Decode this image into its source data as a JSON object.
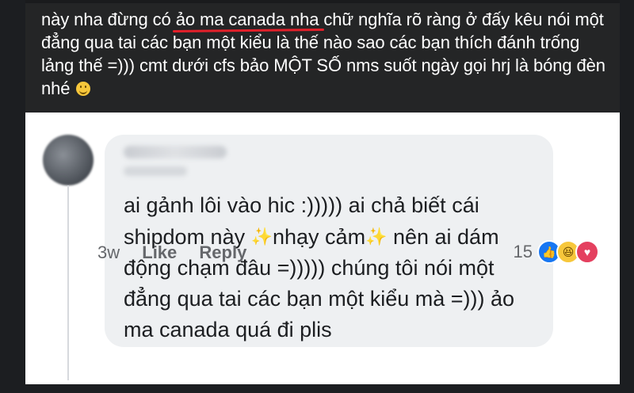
{
  "post": {
    "text_before": "này nha đừng có ",
    "text_highlight": "ảo ma canada nha",
    "text_after": " chữ nghĩa rõ ràng ở đấy kêu nói một đẳng qua tai các bạn một kiểu là thế nào sao các bạn thích đánh trống lảng thế =))) cmt dưới cfs bảo MỘT SỐ nms suốt ngày gọi hrj là bóng đèn nhé",
    "emoji": "smile-emoji"
  },
  "comment": {
    "text_part1": "ai gảnh lôi vào hic :))))) ai chả biết cái shipdom này ",
    "sparkle1": "✨",
    "text_part2": "nhạy cảm",
    "sparkle2": "✨",
    "text_part3": " nên ai dám động chạm đâu =))))) chúng tôi nói một đẳng qua tai các bạn một kiểu mà =))) ảo ma canada quá đi plis",
    "time": "3w",
    "like_label": "Like",
    "reply_label": "Reply",
    "reaction_count": "15",
    "reactions": [
      "like-reaction",
      "haha-reaction",
      "love-reaction"
    ]
  },
  "colors": {
    "post_background": "#242526",
    "highlight_underline": "#e4202a",
    "bubble_background": "#eef0f2",
    "like_blue": "#1877f2"
  }
}
